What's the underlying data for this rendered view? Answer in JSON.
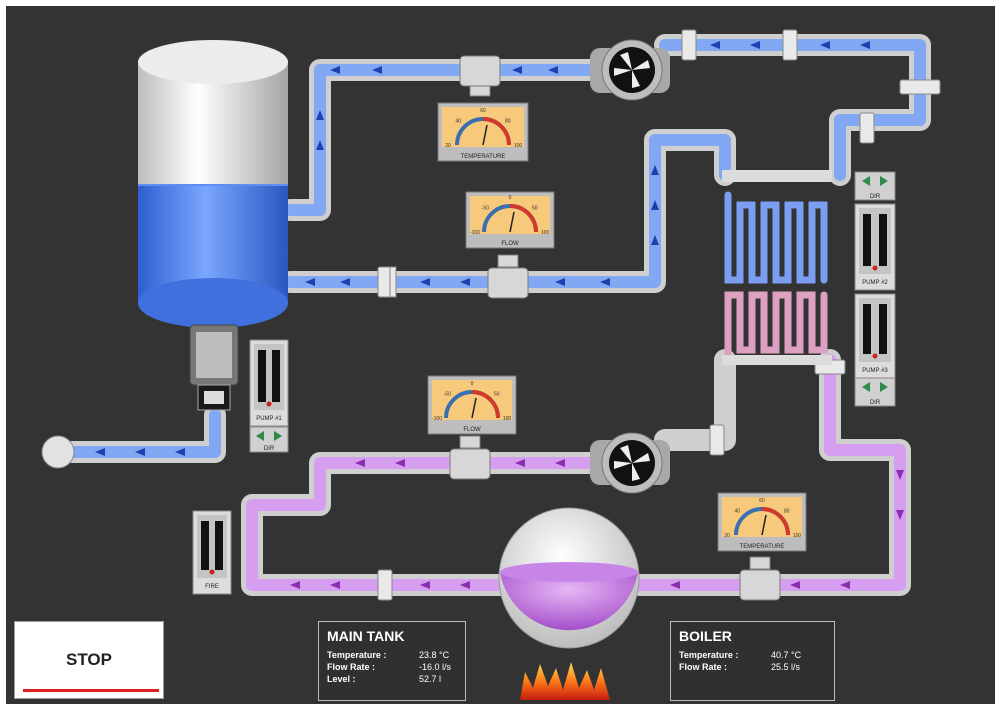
{
  "gauges": {
    "top_temperature": {
      "label": "TEMPERATURE",
      "ticks": [
        "20",
        "40",
        "60",
        "80",
        "100"
      ]
    },
    "upper_flow": {
      "label": "FLOW",
      "ticks": [
        "-100",
        "-50",
        "0",
        "50",
        "100"
      ]
    },
    "lower_flow": {
      "label": "FLOW",
      "ticks": [
        "-100",
        "-50",
        "0",
        "50",
        "100"
      ]
    },
    "boiler_temperature": {
      "label": "TEMPERATURE",
      "ticks": [
        "20",
        "40",
        "60",
        "80",
        "100"
      ]
    }
  },
  "controls": {
    "pump1_label": "PUMP #1",
    "pump2_label": "PUMP #2",
    "pump3_label": "PUMP #3",
    "pump1_dir": "DIR",
    "pump2_dir": "DIR",
    "pump3_dir": "DIR",
    "fire_label": "FIRE"
  },
  "stop_button": {
    "label": "STOP"
  },
  "main_tank": {
    "title": "MAIN TANK",
    "rows": [
      {
        "label": "Temperature :",
        "value": "23.8 °C"
      },
      {
        "label": "Flow Rate :",
        "value": "-16.0 l/s"
      },
      {
        "label": "Level :",
        "value": "52.7 l"
      }
    ],
    "level_fraction": 0.527
  },
  "boiler": {
    "title": "BOILER",
    "rows": [
      {
        "label": "Temperature :",
        "value": "40.7 °C"
      },
      {
        "label": "Flow Rate :",
        "value": "25.5 l/s"
      }
    ]
  },
  "colors": {
    "background": "#333333",
    "cold_fluid": "#6f9bf0",
    "hot_fluid": "#c77fe0",
    "pipe": "#d9d9d9",
    "stop_accent": "#e02020"
  }
}
